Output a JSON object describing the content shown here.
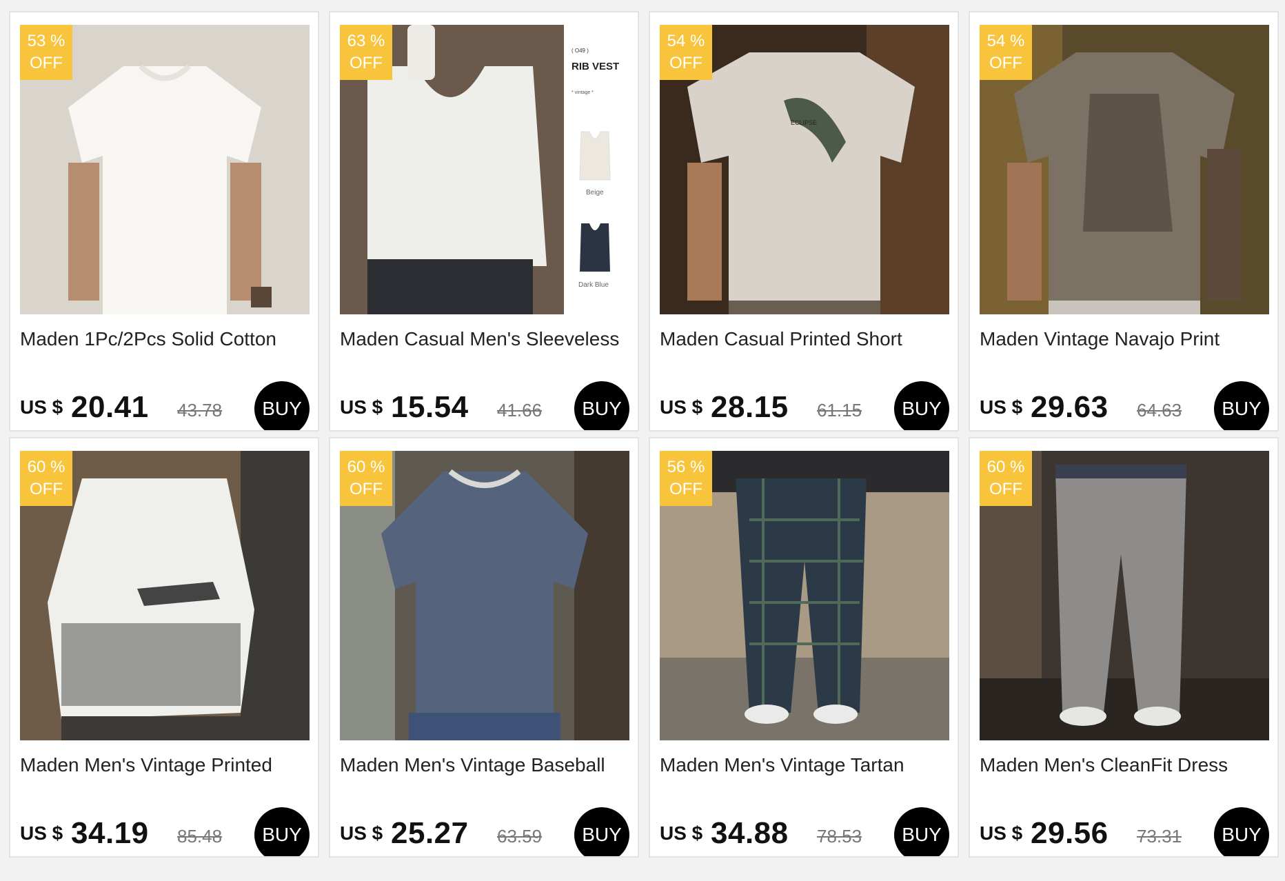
{
  "colors": {
    "badge": "#f7c43c",
    "buy": "#000000",
    "page_bg": "#f2f2f2"
  },
  "products": [
    {
      "discount": "53 %",
      "off": "OFF",
      "title": "Maden 1Pc/2Pcs Solid Cotton",
      "currency": "US $",
      "price": "20.41",
      "old_price": "43.78",
      "buy_label": "BUY",
      "image": "white-tshirt"
    },
    {
      "discount": "63 %",
      "off": "OFF",
      "title": "Maden Casual Men's Sleeveless",
      "currency": "US $",
      "price": "15.54",
      "old_price": "41.66",
      "buy_label": "BUY",
      "image": "rib-vest",
      "image_text": {
        "code": "( O49 )",
        "heading": "RIB VEST",
        "sub": "* vintage *",
        "color1": "Beige",
        "color2": "Dark Blue"
      }
    },
    {
      "discount": "54 %",
      "off": "OFF",
      "title": "Maden Casual Printed Short",
      "currency": "US $",
      "price": "28.15",
      "old_price": "61.15",
      "buy_label": "BUY",
      "image": "marlin-print-tee",
      "image_text": {
        "print": "ECLIPSE"
      }
    },
    {
      "discount": "54 %",
      "off": "OFF",
      "title": "Maden Vintage Navajo Print",
      "currency": "US $",
      "price": "29.63",
      "old_price": "64.63",
      "buy_label": "BUY",
      "image": "navajo-print-tee"
    },
    {
      "discount": "60 %",
      "off": "OFF",
      "title": "Maden Men's Vintage Printed",
      "currency": "US $",
      "price": "34.19",
      "old_price": "85.48",
      "buy_label": "BUY",
      "image": "printed-shirt-back"
    },
    {
      "discount": "60 %",
      "off": "OFF",
      "title": "Maden Men's Vintage Baseball",
      "currency": "US $",
      "price": "25.27",
      "old_price": "63.59",
      "buy_label": "BUY",
      "image": "baseball-henley"
    },
    {
      "discount": "56 %",
      "off": "OFF",
      "title": "Maden Men's Vintage Tartan",
      "currency": "US $",
      "price": "34.88",
      "old_price": "78.53",
      "buy_label": "BUY",
      "image": "tartan-pants"
    },
    {
      "discount": "60 %",
      "off": "OFF",
      "title": "Maden Men's CleanFit Dress",
      "currency": "US $",
      "price": "29.56",
      "old_price": "73.31",
      "buy_label": "BUY",
      "image": "grey-trousers"
    }
  ]
}
